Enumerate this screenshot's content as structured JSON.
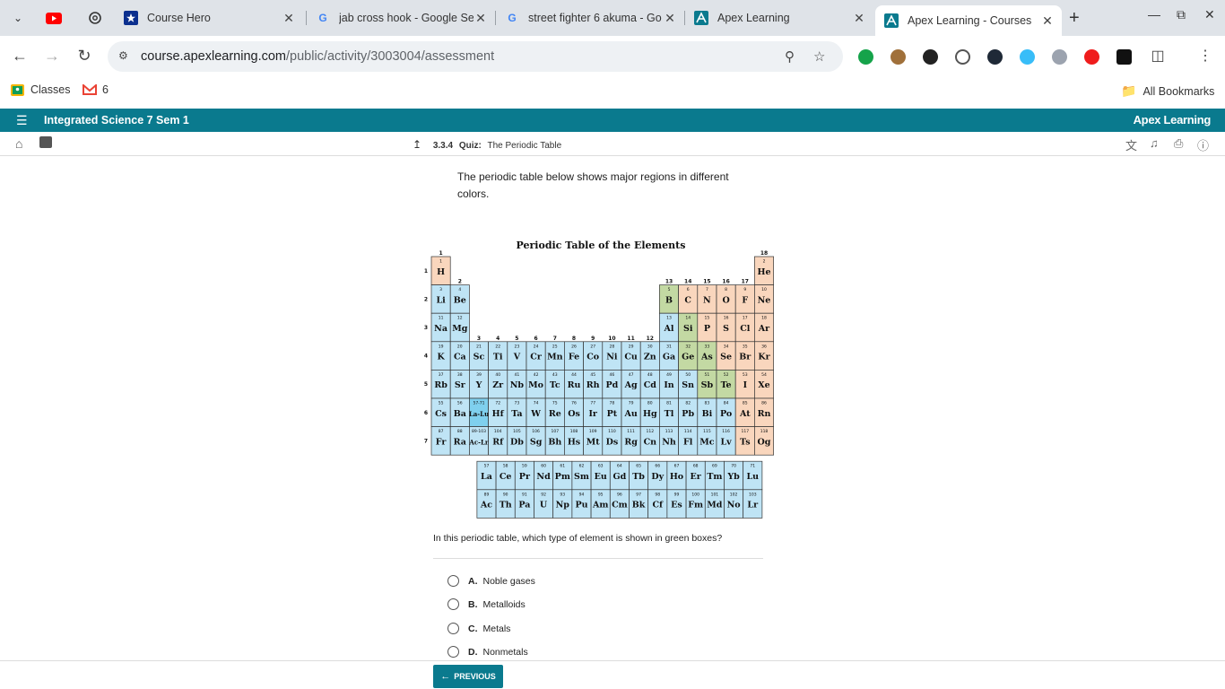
{
  "browser": {
    "tabs": [
      {
        "title": "",
        "icon": "youtube-icon"
      },
      {
        "title": "",
        "icon": "chatgpt-icon"
      },
      {
        "title": "Course Hero",
        "icon": "coursehero-icon"
      },
      {
        "title": "jab cross hook - Google Se",
        "icon": "google-icon"
      },
      {
        "title": "street fighter 6 akuma - Go",
        "icon": "google-icon"
      },
      {
        "title": "Apex Learning",
        "icon": "apex-icon"
      },
      {
        "title": "Apex Learning - Courses",
        "icon": "apex-icon"
      }
    ],
    "url_host": "course.apexlearning.com",
    "url_path": "/public/activity/3003004/assessment",
    "bookmarks": [
      {
        "label": "Classes"
      },
      {
        "label": "6"
      }
    ],
    "all_bookmarks": "All Bookmarks"
  },
  "app": {
    "course_title": "Integrated Science 7 Sem 1",
    "brand": "Apex Learning",
    "breadcrumb_num": "3.3.4",
    "breadcrumb_type": "Quiz:",
    "breadcrumb_title": "The Periodic Table"
  },
  "quiz": {
    "prompt": "The periodic table below shows major regions in different colors.",
    "figure_title": "Periodic Table of the Elements",
    "question": "In this periodic table, which type of element is shown in green boxes?",
    "options": [
      {
        "letter": "A.",
        "text": "Noble gases"
      },
      {
        "letter": "B.",
        "text": "Metalloids"
      },
      {
        "letter": "C.",
        "text": "Metals"
      },
      {
        "letter": "D.",
        "text": "Nonmetals"
      }
    ],
    "prev_label": "PREVIOUS"
  },
  "table": {
    "colors": {
      "metal": "#bfe4f5",
      "metalloid": "#c3d9a3",
      "nonmetal": "#f9d6bd",
      "highlight": "#7fd0ee"
    },
    "group_labels": [
      "1",
      "2",
      "3",
      "4",
      "5",
      "6",
      "7",
      "8",
      "9",
      "10",
      "11",
      "12",
      "13",
      "14",
      "15",
      "16",
      "17",
      "18"
    ],
    "period_labels": [
      "1",
      "2",
      "3",
      "4",
      "5",
      "6",
      "7"
    ],
    "elements": [
      {
        "n": "1",
        "s": "H",
        "c": "nonmetal",
        "p": 1,
        "g": 1
      },
      {
        "n": "2",
        "s": "He",
        "c": "nonmetal",
        "p": 1,
        "g": 18
      },
      {
        "n": "3",
        "s": "Li",
        "c": "metal",
        "p": 2,
        "g": 1
      },
      {
        "n": "4",
        "s": "Be",
        "c": "metal",
        "p": 2,
        "g": 2
      },
      {
        "n": "5",
        "s": "B",
        "c": "metalloid",
        "p": 2,
        "g": 13
      },
      {
        "n": "6",
        "s": "C",
        "c": "nonmetal",
        "p": 2,
        "g": 14
      },
      {
        "n": "7",
        "s": "N",
        "c": "nonmetal",
        "p": 2,
        "g": 15
      },
      {
        "n": "8",
        "s": "O",
        "c": "nonmetal",
        "p": 2,
        "g": 16
      },
      {
        "n": "9",
        "s": "F",
        "c": "nonmetal",
        "p": 2,
        "g": 17
      },
      {
        "n": "10",
        "s": "Ne",
        "c": "nonmetal",
        "p": 2,
        "g": 18
      },
      {
        "n": "11",
        "s": "Na",
        "c": "metal",
        "p": 3,
        "g": 1
      },
      {
        "n": "12",
        "s": "Mg",
        "c": "metal",
        "p": 3,
        "g": 2
      },
      {
        "n": "13",
        "s": "Al",
        "c": "metal",
        "p": 3,
        "g": 13
      },
      {
        "n": "14",
        "s": "Si",
        "c": "metalloid",
        "p": 3,
        "g": 14
      },
      {
        "n": "15",
        "s": "P",
        "c": "nonmetal",
        "p": 3,
        "g": 15
      },
      {
        "n": "16",
        "s": "S",
        "c": "nonmetal",
        "p": 3,
        "g": 16
      },
      {
        "n": "17",
        "s": "Cl",
        "c": "nonmetal",
        "p": 3,
        "g": 17
      },
      {
        "n": "18",
        "s": "Ar",
        "c": "nonmetal",
        "p": 3,
        "g": 18
      },
      {
        "n": "19",
        "s": "K",
        "c": "metal",
        "p": 4,
        "g": 1
      },
      {
        "n": "20",
        "s": "Ca",
        "c": "metal",
        "p": 4,
        "g": 2
      },
      {
        "n": "21",
        "s": "Sc",
        "c": "metal",
        "p": 4,
        "g": 3
      },
      {
        "n": "22",
        "s": "Ti",
        "c": "metal",
        "p": 4,
        "g": 4
      },
      {
        "n": "23",
        "s": "V",
        "c": "metal",
        "p": 4,
        "g": 5
      },
      {
        "n": "24",
        "s": "Cr",
        "c": "metal",
        "p": 4,
        "g": 6
      },
      {
        "n": "25",
        "s": "Mn",
        "c": "metal",
        "p": 4,
        "g": 7
      },
      {
        "n": "26",
        "s": "Fe",
        "c": "metal",
        "p": 4,
        "g": 8
      },
      {
        "n": "27",
        "s": "Co",
        "c": "metal",
        "p": 4,
        "g": 9
      },
      {
        "n": "28",
        "s": "Ni",
        "c": "metal",
        "p": 4,
        "g": 10
      },
      {
        "n": "29",
        "s": "Cu",
        "c": "metal",
        "p": 4,
        "g": 11
      },
      {
        "n": "30",
        "s": "Zn",
        "c": "metal",
        "p": 4,
        "g": 12
      },
      {
        "n": "31",
        "s": "Ga",
        "c": "metal",
        "p": 4,
        "g": 13
      },
      {
        "n": "32",
        "s": "Ge",
        "c": "metalloid",
        "p": 4,
        "g": 14
      },
      {
        "n": "33",
        "s": "As",
        "c": "metalloid",
        "p": 4,
        "g": 15
      },
      {
        "n": "34",
        "s": "Se",
        "c": "nonmetal",
        "p": 4,
        "g": 16
      },
      {
        "n": "35",
        "s": "Br",
        "c": "nonmetal",
        "p": 4,
        "g": 17
      },
      {
        "n": "36",
        "s": "Kr",
        "c": "nonmetal",
        "p": 4,
        "g": 18
      },
      {
        "n": "37",
        "s": "Rb",
        "c": "metal",
        "p": 5,
        "g": 1
      },
      {
        "n": "38",
        "s": "Sr",
        "c": "metal",
        "p": 5,
        "g": 2
      },
      {
        "n": "39",
        "s": "Y",
        "c": "metal",
        "p": 5,
        "g": 3
      },
      {
        "n": "40",
        "s": "Zr",
        "c": "metal",
        "p": 5,
        "g": 4
      },
      {
        "n": "41",
        "s": "Nb",
        "c": "metal",
        "p": 5,
        "g": 5
      },
      {
        "n": "42",
        "s": "Mo",
        "c": "metal",
        "p": 5,
        "g": 6
      },
      {
        "n": "43",
        "s": "Tc",
        "c": "metal",
        "p": 5,
        "g": 7
      },
      {
        "n": "44",
        "s": "Ru",
        "c": "metal",
        "p": 5,
        "g": 8
      },
      {
        "n": "45",
        "s": "Rh",
        "c": "metal",
        "p": 5,
        "g": 9
      },
      {
        "n": "46",
        "s": "Pd",
        "c": "metal",
        "p": 5,
        "g": 10
      },
      {
        "n": "47",
        "s": "Ag",
        "c": "metal",
        "p": 5,
        "g": 11
      },
      {
        "n": "48",
        "s": "Cd",
        "c": "metal",
        "p": 5,
        "g": 12
      },
      {
        "n": "49",
        "s": "In",
        "c": "metal",
        "p": 5,
        "g": 13
      },
      {
        "n": "50",
        "s": "Sn",
        "c": "metal",
        "p": 5,
        "g": 14
      },
      {
        "n": "51",
        "s": "Sb",
        "c": "metalloid",
        "p": 5,
        "g": 15
      },
      {
        "n": "52",
        "s": "Te",
        "c": "metalloid",
        "p": 5,
        "g": 16
      },
      {
        "n": "53",
        "s": "I",
        "c": "nonmetal",
        "p": 5,
        "g": 17
      },
      {
        "n": "54",
        "s": "Xe",
        "c": "nonmetal",
        "p": 5,
        "g": 18
      },
      {
        "n": "55",
        "s": "Cs",
        "c": "metal",
        "p": 6,
        "g": 1
      },
      {
        "n": "56",
        "s": "Ba",
        "c": "metal",
        "p": 6,
        "g": 2
      },
      {
        "n": "57-71",
        "s": "La-Lu",
        "c": "highlight",
        "p": 6,
        "g": 3
      },
      {
        "n": "72",
        "s": "Hf",
        "c": "metal",
        "p": 6,
        "g": 4
      },
      {
        "n": "73",
        "s": "Ta",
        "c": "metal",
        "p": 6,
        "g": 5
      },
      {
        "n": "74",
        "s": "W",
        "c": "metal",
        "p": 6,
        "g": 6
      },
      {
        "n": "75",
        "s": "Re",
        "c": "metal",
        "p": 6,
        "g": 7
      },
      {
        "n": "76",
        "s": "Os",
        "c": "metal",
        "p": 6,
        "g": 8
      },
      {
        "n": "77",
        "s": "Ir",
        "c": "metal",
        "p": 6,
        "g": 9
      },
      {
        "n": "78",
        "s": "Pt",
        "c": "metal",
        "p": 6,
        "g": 10
      },
      {
        "n": "79",
        "s": "Au",
        "c": "metal",
        "p": 6,
        "g": 11
      },
      {
        "n": "80",
        "s": "Hg",
        "c": "metal",
        "p": 6,
        "g": 12
      },
      {
        "n": "81",
        "s": "Tl",
        "c": "metal",
        "p": 6,
        "g": 13
      },
      {
        "n": "82",
        "s": "Pb",
        "c": "metal",
        "p": 6,
        "g": 14
      },
      {
        "n": "83",
        "s": "Bi",
        "c": "metal",
        "p": 6,
        "g": 15
      },
      {
        "n": "84",
        "s": "Po",
        "c": "metal",
        "p": 6,
        "g": 16
      },
      {
        "n": "85",
        "s": "At",
        "c": "nonmetal",
        "p": 6,
        "g": 17
      },
      {
        "n": "86",
        "s": "Rn",
        "c": "nonmetal",
        "p": 6,
        "g": 18
      },
      {
        "n": "87",
        "s": "Fr",
        "c": "metal",
        "p": 7,
        "g": 1
      },
      {
        "n": "88",
        "s": "Ra",
        "c": "metal",
        "p": 7,
        "g": 2
      },
      {
        "n": "89-103",
        "s": "Ac-Lr",
        "c": "metal",
        "p": 7,
        "g": 3
      },
      {
        "n": "104",
        "s": "Rf",
        "c": "metal",
        "p": 7,
        "g": 4
      },
      {
        "n": "105",
        "s": "Db",
        "c": "metal",
        "p": 7,
        "g": 5
      },
      {
        "n": "106",
        "s": "Sg",
        "c": "metal",
        "p": 7,
        "g": 6
      },
      {
        "n": "107",
        "s": "Bh",
        "c": "metal",
        "p": 7,
        "g": 7
      },
      {
        "n": "108",
        "s": "Hs",
        "c": "metal",
        "p": 7,
        "g": 8
      },
      {
        "n": "109",
        "s": "Mt",
        "c": "metal",
        "p": 7,
        "g": 9
      },
      {
        "n": "110",
        "s": "Ds",
        "c": "metal",
        "p": 7,
        "g": 10
      },
      {
        "n": "111",
        "s": "Rg",
        "c": "metal",
        "p": 7,
        "g": 11
      },
      {
        "n": "112",
        "s": "Cn",
        "c": "metal",
        "p": 7,
        "g": 12
      },
      {
        "n": "113",
        "s": "Nh",
        "c": "metal",
        "p": 7,
        "g": 13
      },
      {
        "n": "114",
        "s": "Fl",
        "c": "metal",
        "p": 7,
        "g": 14
      },
      {
        "n": "115",
        "s": "Mc",
        "c": "metal",
        "p": 7,
        "g": 15
      },
      {
        "n": "116",
        "s": "Lv",
        "c": "metal",
        "p": 7,
        "g": 16
      },
      {
        "n": "117",
        "s": "Ts",
        "c": "nonmetal",
        "p": 7,
        "g": 17
      },
      {
        "n": "118",
        "s": "Og",
        "c": "nonmetal",
        "p": 7,
        "g": 18
      }
    ],
    "lanthanides": [
      {
        "n": "57",
        "s": "La"
      },
      {
        "n": "58",
        "s": "Ce"
      },
      {
        "n": "59",
        "s": "Pr"
      },
      {
        "n": "60",
        "s": "Nd"
      },
      {
        "n": "61",
        "s": "Pm"
      },
      {
        "n": "62",
        "s": "Sm"
      },
      {
        "n": "63",
        "s": "Eu"
      },
      {
        "n": "64",
        "s": "Gd"
      },
      {
        "n": "65",
        "s": "Tb"
      },
      {
        "n": "66",
        "s": "Dy"
      },
      {
        "n": "67",
        "s": "Ho"
      },
      {
        "n": "68",
        "s": "Er"
      },
      {
        "n": "69",
        "s": "Tm"
      },
      {
        "n": "70",
        "s": "Yb"
      },
      {
        "n": "71",
        "s": "Lu"
      }
    ],
    "actinides": [
      {
        "n": "89",
        "s": "Ac"
      },
      {
        "n": "90",
        "s": "Th"
      },
      {
        "n": "91",
        "s": "Pa"
      },
      {
        "n": "92",
        "s": "U"
      },
      {
        "n": "93",
        "s": "Np"
      },
      {
        "n": "94",
        "s": "Pu"
      },
      {
        "n": "95",
        "s": "Am"
      },
      {
        "n": "96",
        "s": "Cm"
      },
      {
        "n": "97",
        "s": "Bk"
      },
      {
        "n": "98",
        "s": "Cf"
      },
      {
        "n": "99",
        "s": "Es"
      },
      {
        "n": "100",
        "s": "Fm"
      },
      {
        "n": "101",
        "s": "Md"
      },
      {
        "n": "102",
        "s": "No"
      },
      {
        "n": "103",
        "s": "Lr"
      }
    ]
  }
}
